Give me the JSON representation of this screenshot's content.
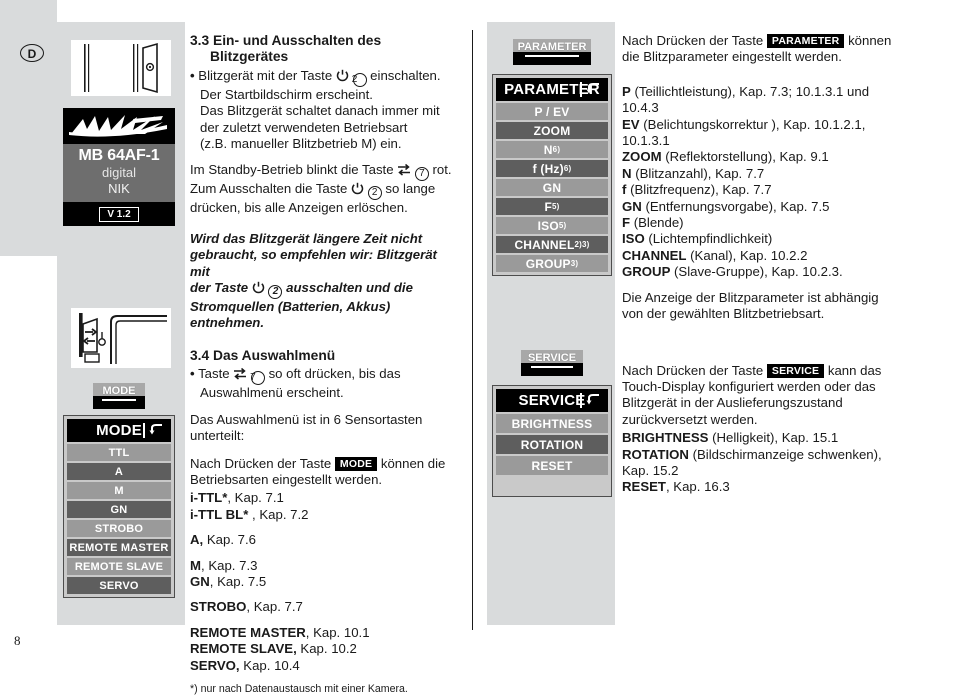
{
  "page": {
    "number": "8",
    "language_badge": "D"
  },
  "device_display": {
    "brand_logo": "metz-wordmark",
    "model": "MB 64AF-1",
    "variant": "digital",
    "mount": "NIK",
    "version": "V 1.2"
  },
  "hardware_keys": {
    "mode": "MODE",
    "parameter": "PARAMETER",
    "service": "SERVICE"
  },
  "lcd_mode": {
    "title": "MODE",
    "back_icon": "back-arrow-icon",
    "rows": [
      "TTL",
      "A",
      "M",
      "GN",
      "STROBO",
      "REMOTE MASTER",
      "REMOTE SLAVE",
      "SERVO"
    ]
  },
  "lcd_parameter": {
    "title": "PARAMETER",
    "back_icon": "back-arrow-icon",
    "rows": [
      {
        "label": "P / EV",
        "sup": ""
      },
      {
        "label": "ZOOM",
        "sup": ""
      },
      {
        "label": "N",
        "sup": "6)"
      },
      {
        "label": "f (Hz)",
        "sup": "6)"
      },
      {
        "label": "GN",
        "sup": ""
      },
      {
        "label": "F",
        "sup": "5)"
      },
      {
        "label": "ISO",
        "sup": "5)"
      },
      {
        "label": "CHANNEL",
        "sup": "2)3)"
      },
      {
        "label": "GROUP ",
        "sup": "3)"
      }
    ]
  },
  "lcd_service": {
    "title": "SERVICE",
    "back_icon": "back-arrow-icon",
    "rows": [
      "BRIGHTNESS",
      "ROTATION",
      "RESET"
    ]
  },
  "main_column": {
    "section_33": {
      "number_title": "3.3 Ein- und Ausschalten des",
      "title_line2": "Blitzgerätes"
    },
    "bullet_33": {
      "part1": "Blitzgerät mit der Taste ",
      "part2": " einschalten.",
      "line2": "Der Startbildschirm erscheint.",
      "line3": "Das Blitzgerät schaltet danach immer mit",
      "line4": "der zuletzt verwendeten Betriebsart",
      "line5": "(z.B. manueller Blitzbetrieb M) ein.",
      "key_number": "2"
    },
    "standby": {
      "line1_a": "Im Standby-Betrieb blinkt die Taste ",
      "line1_b": " rot.",
      "line1_num": "7",
      "line2_a": "Zum Ausschalten die Taste ",
      "line2_b": " so lange",
      "line2_num": "2",
      "line3": "drücken, bis alle Anzeigen erlöschen."
    },
    "note": {
      "line1": "Wird das Blitzgerät längere Zeit nicht",
      "line2": "gebraucht, so empfehlen wir: Blitzgerät mit",
      "line3_a": "der Taste ",
      "line3_b": " ausschalten und die",
      "line3_num": "2",
      "line4": "Stromquellen (Batterien, Akkus) entnehmen."
    },
    "section_34": {
      "title": "3.4 Das Auswahlmenü"
    },
    "bullet_34": {
      "part1": "Taste ",
      "part2": " so oft drücken, bis das",
      "key_number": "7",
      "line2": "Auswahlmenü erscheint."
    },
    "para_subdivided": {
      "line1": "Das Auswahlmenü ist in 6 Sensortasten",
      "line2": "unterteilt:"
    },
    "para_mode": {
      "part1": "Nach Drücken der Taste ",
      "key": "MODE",
      "part2": " können die",
      "line2": "Betriebsarten eingestellt werden."
    },
    "mode_list": [
      {
        "name": "i-TTL*",
        "rest": ", Kap. 7.1",
        "space": false
      },
      {
        "name": "i-TTL BL*",
        "rest": " , Kap. 7.2",
        "space": false
      },
      {
        "name": "A,",
        "rest": " Kap. 7.6",
        "space": true
      },
      {
        "name": "M",
        "rest": ", Kap. 7.3",
        "space": true
      },
      {
        "name": "GN",
        "rest": ", Kap. 7.5",
        "space": false
      },
      {
        "name": "STROBO",
        "rest": ", Kap. 7.7",
        "space": true
      },
      {
        "name": "REMOTE MASTER",
        "rest": ", Kap. 10.1",
        "space": true
      },
      {
        "name": "REMOTE SLAVE,",
        "rest": " Kap. 10.2",
        "space": false
      },
      {
        "name": "SERVO,",
        "rest": " Kap. 10.4",
        "space": false
      }
    ],
    "footnote": "*) nur nach Datenaustausch mit einer Kamera."
  },
  "right_column": {
    "para_parameter": {
      "part1": "Nach Drücken der Taste ",
      "key": "PARAMETER",
      "part2": " können",
      "line2": "die Blitzparameter eingestellt werden."
    },
    "parameter_list": [
      {
        "name": "P",
        "rest": " (Teillichtleistung), Kap. 7.3; 10.1.3.1 und"
      },
      {
        "name": "",
        "rest": "10.4.3"
      },
      {
        "name": "EV",
        "rest": " (Belichtungskorrektur ), Kap. 10.1.2.1,"
      },
      {
        "name": "",
        "rest": "10.1.3.1"
      },
      {
        "name": "ZOOM",
        "rest": " (Reflektorstellung), Kap. 9.1"
      },
      {
        "name": "N",
        "rest": " (Blitzanzahl), Kap. 7.7"
      },
      {
        "name": "f",
        "rest": " (Blitzfrequenz), Kap. 7.7"
      },
      {
        "name": "GN",
        "rest": " (Entfernungsvorgabe), Kap. 7.5"
      },
      {
        "name": "F",
        "rest": " (Blende)"
      },
      {
        "name": "ISO",
        "rest": " (Lichtempfindlichkeit)"
      },
      {
        "name": "CHANNEL",
        "rest": " (Kanal), Kap. 10.2.2"
      },
      {
        "name": "GROUP",
        "rest": " (Slave-Gruppe), Kap. 10.2.3."
      }
    ],
    "para_depends": {
      "line1": "Die Anzeige der Blitzparameter ist abhängig",
      "line2": "von der gewählten Blitzbetriebsart."
    },
    "para_service": {
      "part1": "Nach Drücken der Taste ",
      "key": "SERVICE",
      "part2": " kann das",
      "line2": "Touch-Display konfiguriert werden oder das",
      "line3": "Blitzgerät in der Auslieferungszustand",
      "line4": "zurückversetzt werden."
    },
    "service_list": [
      {
        "name": "BRIGHTNESS",
        "rest": " (Helligkeit), Kap. 15.1"
      },
      {
        "name": "ROTATION",
        "rest": " (Bildschirmanzeige schwenken),"
      },
      {
        "name": "",
        "rest": "Kap. 15.2"
      },
      {
        "name": "RESET",
        "rest": ", Kap. 16.3"
      }
    ]
  },
  "colors": {
    "plate_grey": "#d9dbdc",
    "lcd_frame": "#4d4d4d",
    "lcd_bg": "#c9c9c9",
    "row_light": "#9a9a9a",
    "row_dark": "#5e5e5e",
    "panel_grey": "#6e6e6e"
  }
}
